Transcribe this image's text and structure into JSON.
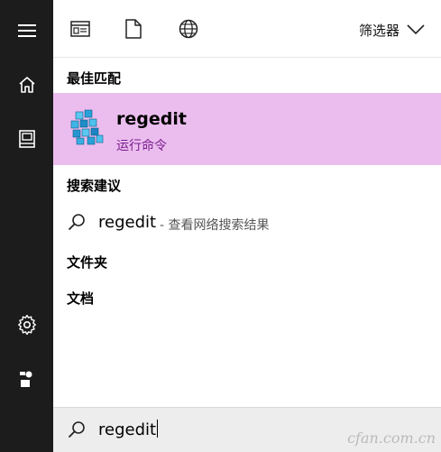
{
  "rail": {
    "icons": [
      "hamburger-icon",
      "home-icon",
      "notebook-icon",
      "gear-icon",
      "feedback-icon"
    ]
  },
  "topbar": {
    "filter_label": "筛选器",
    "icons": [
      "apps-filter-icon",
      "documents-filter-icon",
      "web-filter-icon",
      "chevron-down-icon"
    ]
  },
  "sections": {
    "best_match": "最佳匹配",
    "suggestions": "搜索建议",
    "folders": "文件夹",
    "documents": "文档"
  },
  "best_match": {
    "title": "regedit",
    "subtitle": "运行命令",
    "icon": "registry-editor-icon",
    "highlight_color": "#ebbdee",
    "subtitle_color": "#7a1d8f"
  },
  "suggestion": {
    "term": "regedit",
    "hint": "- 查看网络搜索结果",
    "icon": "search-icon"
  },
  "search": {
    "value": "regedit",
    "icon": "search-icon"
  },
  "watermark": "cfan.com.cn"
}
